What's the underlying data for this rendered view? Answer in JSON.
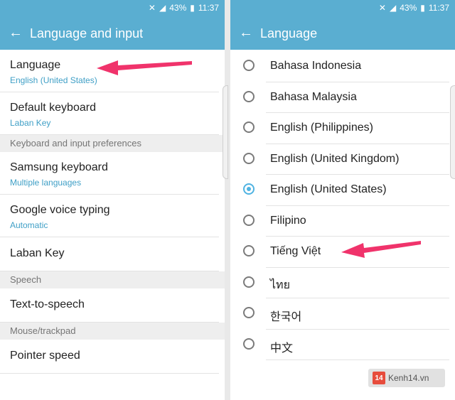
{
  "status": {
    "mute": "✕",
    "signal": "◢",
    "battery_pct": "43%",
    "battery_icon": "▮",
    "time": "11:37"
  },
  "left": {
    "title": "Language and input",
    "items": [
      {
        "title": "Language",
        "subtitle": "English (United States)"
      },
      {
        "title": "Default keyboard",
        "subtitle": "Laban Key"
      }
    ],
    "section_keyboard": "Keyboard and input preferences",
    "keyboard_items": [
      {
        "title": "Samsung keyboard",
        "subtitle": "Multiple languages"
      },
      {
        "title": "Google voice typing",
        "subtitle": "Automatic"
      },
      {
        "title": "Laban Key"
      }
    ],
    "section_speech": "Speech",
    "speech_items": [
      {
        "title": "Text-to-speech"
      }
    ],
    "section_mouse": "Mouse/trackpad",
    "mouse_items": [
      {
        "title": "Pointer speed"
      }
    ]
  },
  "right": {
    "title": "Language",
    "languages": [
      {
        "name": "Bahasa Indonesia",
        "selected": false
      },
      {
        "name": "Bahasa Malaysia",
        "selected": false
      },
      {
        "name": "English (Philippines)",
        "selected": false
      },
      {
        "name": "English (United Kingdom)",
        "selected": false
      },
      {
        "name": "English (United States)",
        "selected": true
      },
      {
        "name": "Filipino",
        "selected": false
      },
      {
        "name": "Tiếng Việt",
        "selected": false
      },
      {
        "name": "ไทย",
        "selected": false
      },
      {
        "name": "한국어",
        "selected": false
      },
      {
        "name": "中文",
        "selected": false
      }
    ]
  },
  "watermark": {
    "logo": "14",
    "text": "Kenh14.vn"
  },
  "colors": {
    "accent": "#5aaed1",
    "radio_selected": "#4fb3e2",
    "arrow": "#f0336b"
  }
}
